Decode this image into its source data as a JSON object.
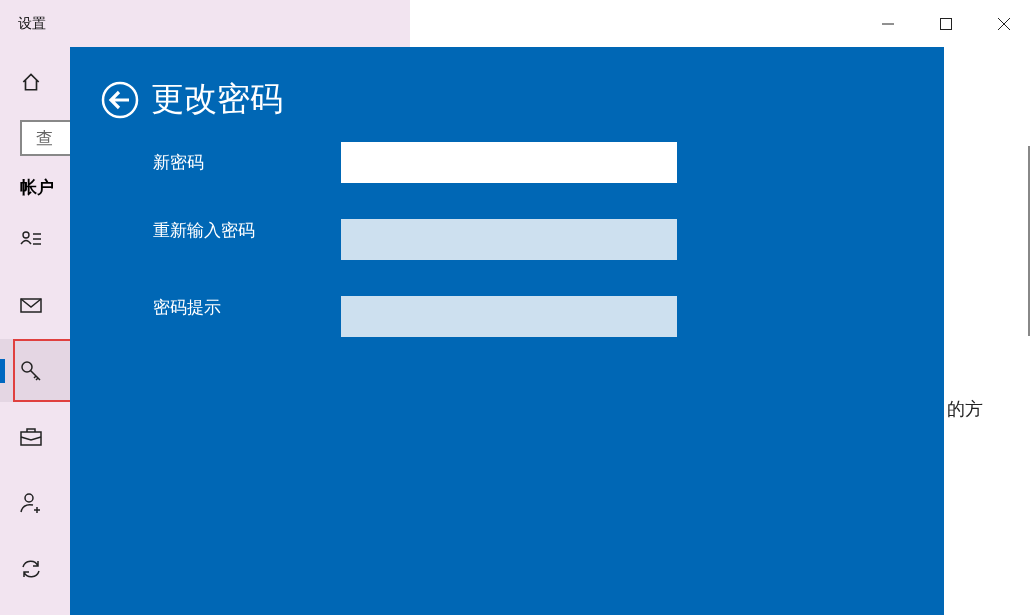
{
  "window": {
    "title": "设置"
  },
  "sidebar": {
    "search": {
      "placeholder": "查"
    },
    "section_title": "帐户",
    "items": [
      {
        "selected": false,
        "highlighted": false
      },
      {
        "selected": false,
        "highlighted": false
      },
      {
        "selected": true,
        "highlighted": true
      },
      {
        "selected": false,
        "highlighted": false
      },
      {
        "selected": false,
        "highlighted": false
      },
      {
        "selected": false,
        "highlighted": false
      }
    ]
  },
  "content": {
    "text_fragment": "的方"
  },
  "dialog": {
    "title": "更改密码",
    "fields": [
      {
        "label": "新密码",
        "focused": true
      },
      {
        "label": "重新输入密码",
        "focused": false
      },
      {
        "label": "密码提示",
        "focused": false
      }
    ]
  }
}
